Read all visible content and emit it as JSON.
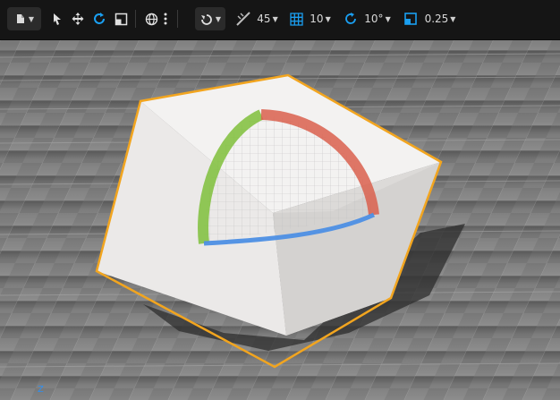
{
  "toolbar": {
    "translation_snap": "45",
    "grid_snap": "10",
    "rotation_snap": "10°",
    "scale_snap": "0.25"
  },
  "viewport": {
    "axis_label": "Z"
  },
  "colors": {
    "accent": "#1a9ff1",
    "selection_outline": "#f2a51f",
    "gizmo_x": "#c8412e",
    "gizmo_y": "#7fbf3b",
    "gizmo_z": "#3b86e0"
  }
}
